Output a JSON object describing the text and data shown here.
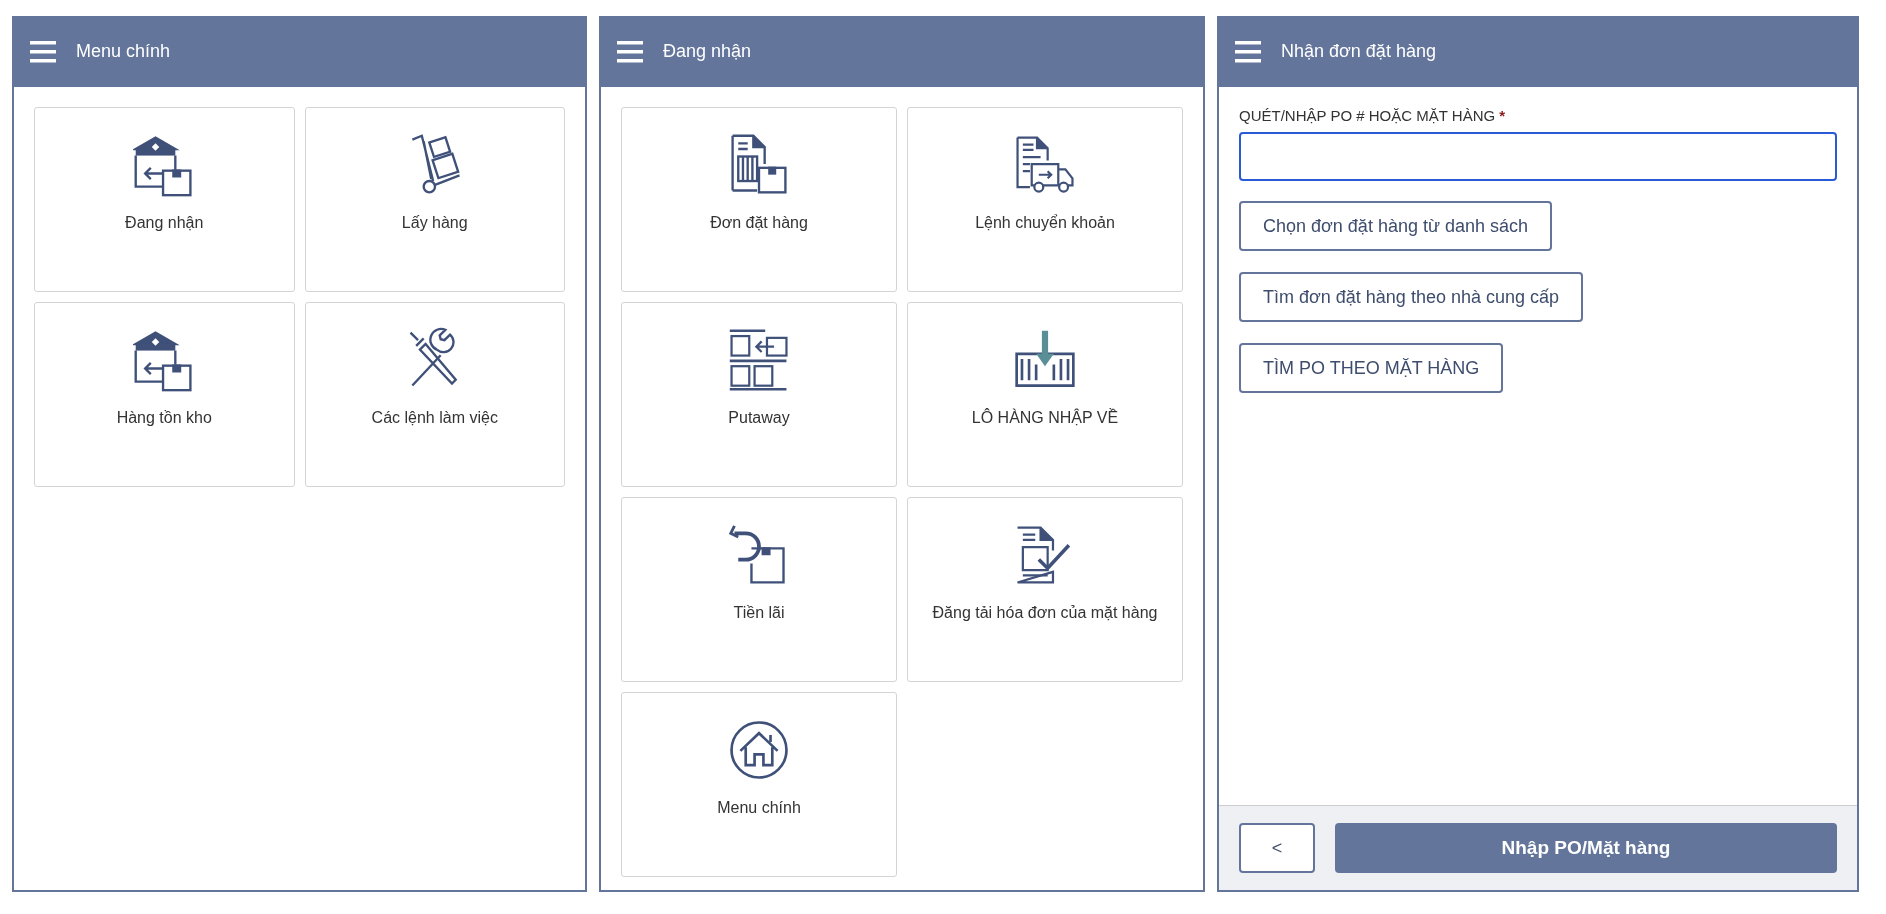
{
  "panels": [
    {
      "kind": "menu",
      "title": "Menu chính",
      "tiles": [
        {
          "label": "Đang nhận",
          "kind": "receive"
        },
        {
          "label": "Lấy hàng",
          "kind": "cart"
        },
        {
          "label": "Hàng tồn kho",
          "kind": "receive"
        },
        {
          "label": "Các lệnh làm việc",
          "kind": "tools"
        }
      ]
    },
    {
      "kind": "menu",
      "title": "Đang nhận",
      "tiles": [
        {
          "label": "Đơn đặt hàng",
          "kind": "order"
        },
        {
          "label": "Lệnh chuyển khoản",
          "kind": "transfer"
        },
        {
          "label": "Putaway",
          "kind": "putaway"
        },
        {
          "label": "LÔ HÀNG NHẬP VỀ",
          "kind": "container"
        },
        {
          "label": "Tiền lãi",
          "kind": "return"
        },
        {
          "label": "Đăng tải hóa đơn của mặt hàng",
          "kind": "upload"
        },
        {
          "label": "Menu chính",
          "kind": "home"
        }
      ]
    },
    {
      "kind": "form",
      "title": "Nhận đơn đặt hàng",
      "field": {
        "label": "QUÉT/NHẬP PO # HOẶC MẶT HÀNG",
        "required_mark": "*",
        "focused": true
      },
      "buttons": [
        "Chọn đơn đặt hàng từ danh sách",
        "Tìm đơn đặt hàng theo nhà cung cấp",
        "TÌM PO THEO MẶT HÀNG"
      ],
      "footer": {
        "back": "<",
        "submit": "Nhập PO/Mặt hàng"
      }
    }
  ]
}
